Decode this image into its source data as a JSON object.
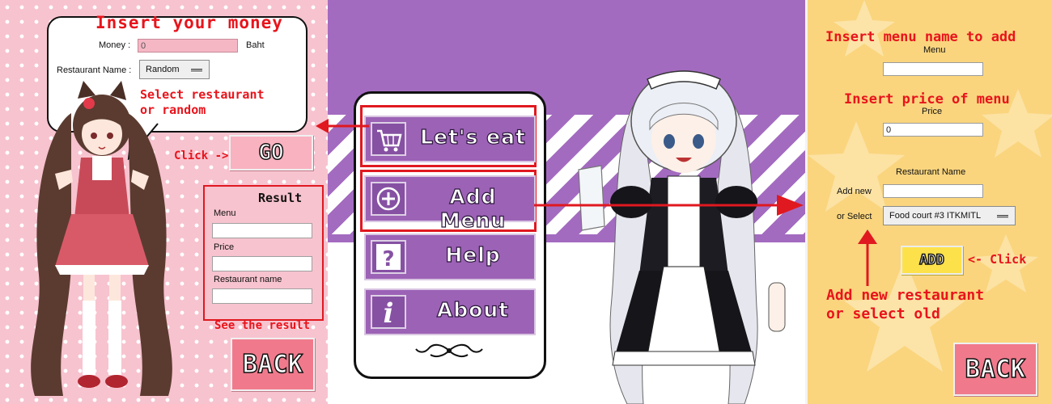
{
  "left_panel": {
    "title": "Insert your money",
    "money_label": "Money :",
    "money_value": "0",
    "money_unit": "Baht",
    "restaurant_label": "Restaurant Name :",
    "restaurant_selected": "Random",
    "hint_select": [
      "Select restaurant",
      "or random"
    ],
    "click_hint": "Click ->",
    "go_button": "GO",
    "result_title": "Result",
    "result_menu_label": "Menu",
    "result_price_label": "Price",
    "result_restaurant_label": "Restaurant name",
    "see_result_hint": "See the result",
    "back_button": "BACK"
  },
  "center_panel": {
    "menu_items": [
      {
        "label": "Let's eat",
        "icon": "cart-icon"
      },
      {
        "label": "Add Menu",
        "icon": "plus-circle-icon"
      },
      {
        "label": "Help",
        "icon": "question-icon"
      },
      {
        "label": "About",
        "icon": "info-icon"
      }
    ]
  },
  "right_panel": {
    "title_menu": "Insert menu name to add",
    "menu_label": "Menu",
    "menu_value": "",
    "title_price": "Insert price of menu",
    "price_label": "Price",
    "price_value": "0",
    "restaurant_label": "Restaurant Name",
    "add_new_label": "Add new",
    "add_new_value": "",
    "or_select_label": "or Select",
    "select_value": "Food court #3 ITKMITL",
    "add_button": "ADD",
    "click_hint": "<- Click",
    "hint_add": [
      "Add new restaurant",
      "or select old"
    ],
    "back_button": "BACK"
  },
  "colors": {
    "accent_red": "#e01820",
    "left_bg": "#f7c3cf",
    "center_purple": "#a36bc0",
    "menu_button": "#9c62b6",
    "right_bg": "#fad57e",
    "add_button": "#fde14a"
  }
}
